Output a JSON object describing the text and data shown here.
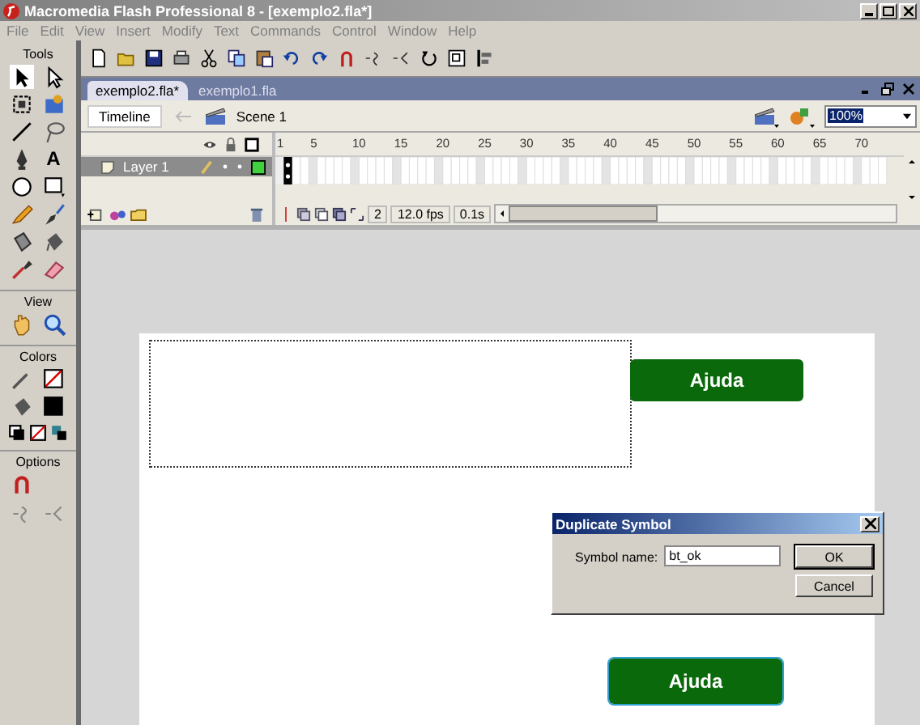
{
  "window": {
    "title": "Macromedia Flash Professional 8 - [exemplo2.fla*]"
  },
  "menu": [
    "File",
    "Edit",
    "View",
    "Insert",
    "Modify",
    "Text",
    "Commands",
    "Control",
    "Window",
    "Help"
  ],
  "tools_panel": {
    "title": "Tools",
    "text_tool": "A",
    "sections": [
      "View",
      "Colors",
      "Options"
    ]
  },
  "document_tabs": [
    {
      "label": "exemplo2.fla*",
      "selected": true
    },
    {
      "label": "exemplo1.fla",
      "selected": false
    }
  ],
  "edit_bar": {
    "timeline_button": "Timeline",
    "scene": "Scene 1",
    "zoom": "100%"
  },
  "timeline": {
    "frame_numbers": [
      "1",
      "5",
      "10",
      "15",
      "20",
      "25",
      "30",
      "35",
      "40",
      "45",
      "50",
      "55",
      "60",
      "65",
      "70"
    ],
    "layers": [
      {
        "name": "Layer 1",
        "selected": true
      }
    ],
    "current_frame": "2",
    "frame_rate": "12.0 fps",
    "elapsed": "0.1s"
  },
  "stage": {
    "buttons": [
      {
        "label": "Ajuda",
        "selected": false
      },
      {
        "label": "Ajuda",
        "selected": true
      }
    ]
  },
  "dialog": {
    "title": "Duplicate Symbol",
    "field_label": "Symbol name:",
    "field_value": "bt_ok",
    "buttons": [
      "OK",
      "Cancel"
    ]
  }
}
